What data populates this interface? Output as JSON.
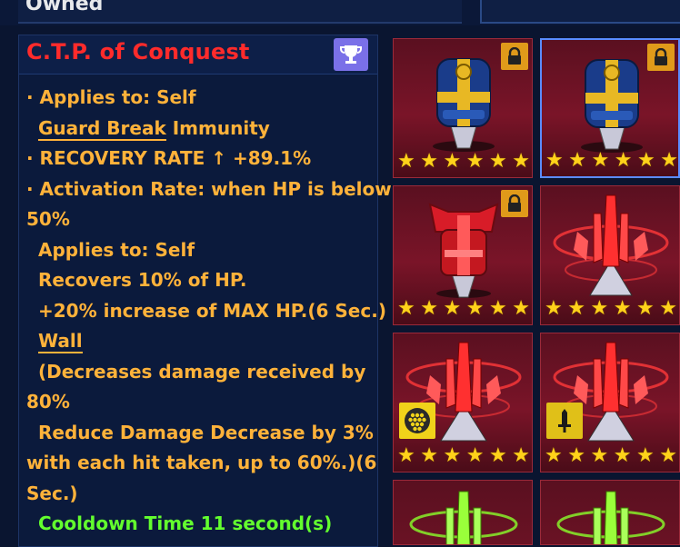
{
  "header": {
    "tab_label": "Owned"
  },
  "skill": {
    "title": "C.T.P. of Conquest",
    "lines": [
      "· Applies to: Self",
      "Guard Break",
      "Immunity",
      "· RECOVERY RATE ↑ +89.1%",
      "· Activation Rate: when HP is below",
      "50%",
      "Applies to: Self",
      "Recovers 10% of HP.",
      "+20% increase of MAX HP.(6 Sec.)",
      "Wall",
      "(Decreases damage received by",
      "80%",
      "Reduce Damage Decrease by 3%",
      "with each hit taken, up to 60%.)(6",
      "Sec.)",
      "Cooldown Time 11 second(s)"
    ]
  },
  "items": [
    {
      "type": "blue-gold-ctp",
      "locked": true,
      "selected": false,
      "stars": 6
    },
    {
      "type": "blue-gold-ctp",
      "locked": true,
      "selected": true,
      "stars": 6
    },
    {
      "type": "red-ctp",
      "locked": true,
      "selected": false,
      "stars": 6
    },
    {
      "type": "red-crystal-ctp",
      "locked": false,
      "selected": false,
      "stars": 6
    },
    {
      "type": "red-crystal-ctp",
      "locked": false,
      "selected": false,
      "stars": 6,
      "badge": "shield-grid-icon"
    },
    {
      "type": "red-crystal-ctp",
      "locked": false,
      "selected": false,
      "stars": 6,
      "badge": "sword-icon"
    },
    {
      "type": "green-crystal-ctp",
      "locked": false,
      "selected": false
    },
    {
      "type": "green-crystal-ctp",
      "locked": false,
      "selected": false
    }
  ],
  "colors": {
    "title": "#ff2b2b",
    "text": "#ffb23a",
    "cooldown": "#63ff2e",
    "trophy": "#7a70e8",
    "lock": "#e09a1a",
    "star": "#ffd21a"
  }
}
